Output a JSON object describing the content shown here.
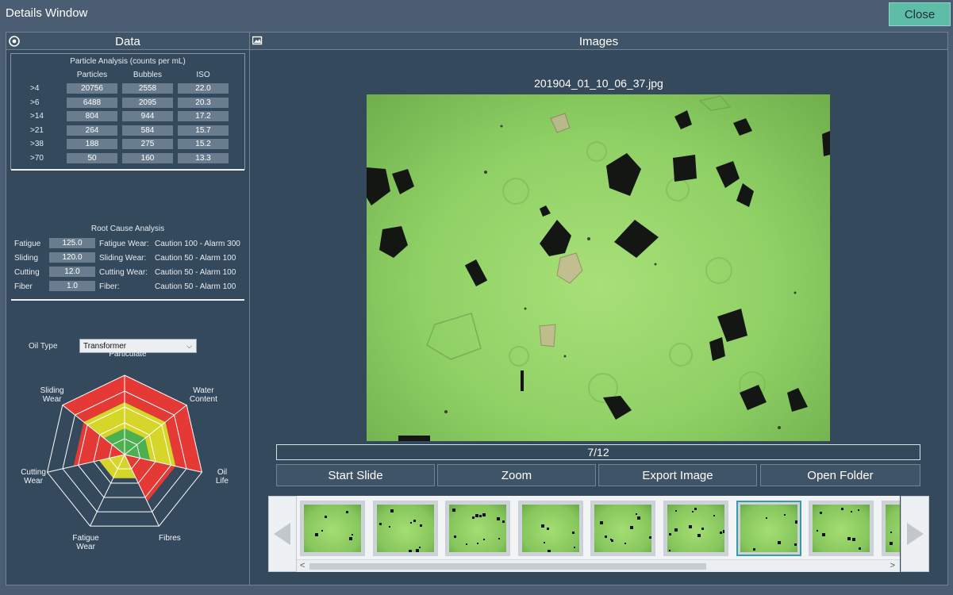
{
  "window": {
    "title": "Details Window",
    "close_label": "Close"
  },
  "data_panel": {
    "title": "Data",
    "particle_analysis": {
      "title": "Particle Analysis (counts per mL)",
      "columns": [
        "Particles",
        "Bubbles",
        "ISO"
      ],
      "rows": [
        {
          "label": ">4",
          "values": [
            "20756",
            "2558",
            "22.0"
          ]
        },
        {
          "label": ">6",
          "values": [
            "6488",
            "2095",
            "20.3"
          ]
        },
        {
          "label": ">14",
          "values": [
            "804",
            "944",
            "17.2"
          ]
        },
        {
          "label": ">21",
          "values": [
            "264",
            "584",
            "15.7"
          ]
        },
        {
          "label": ">38",
          "values": [
            "188",
            "275",
            "15.2"
          ]
        },
        {
          "label": ">70",
          "values": [
            "50",
            "160",
            "13.3"
          ]
        }
      ]
    },
    "root_cause": {
      "title": "Root Cause Analysis",
      "rows": [
        {
          "label": "Fatigue",
          "value": "125.0",
          "name": "Fatigue Wear:",
          "limits": "Caution 100 - Alarm 300"
        },
        {
          "label": "Sliding",
          "value": "120.0",
          "name": "Sliding Wear:",
          "limits": "Caution 50 - Alarm 100"
        },
        {
          "label": "Cutting",
          "value": "12.0",
          "name": "Cutting Wear:",
          "limits": "Caution 50 - Alarm 100"
        },
        {
          "label": "Fiber",
          "value": "1.0",
          "name": "Fiber:",
          "limits": "Caution 50 - Alarm 100"
        }
      ]
    },
    "oil_type": {
      "label": "Oil Type",
      "value": "Transformer"
    },
    "radar": {
      "axes": [
        {
          "name": "Particulate",
          "lines": [
            "Particulate"
          ],
          "level": 1.0
        },
        {
          "name": "Water Content",
          "lines": [
            "Water",
            "Content"
          ],
          "level": 1.0
        },
        {
          "name": "Oil Life",
          "lines": [
            "Oil",
            "Life"
          ],
          "level": 1.0
        },
        {
          "name": "Fibres",
          "lines": [
            "Fibres"
          ],
          "level": 0.0
        },
        {
          "name": "Fatigue Wear",
          "lines": [
            "Fatigue",
            "Wear"
          ],
          "level": 0.5
        },
        {
          "name": "Cutting Wear",
          "lines": [
            "Cutting",
            "Wear"
          ],
          "level": 0.0
        },
        {
          "name": "Sliding Wear",
          "lines": [
            "Sliding",
            "Wear"
          ],
          "level": 1.0
        }
      ],
      "colors": {
        "low": "#4caf50",
        "mid": "#d6d62a",
        "high": "#e53935"
      }
    }
  },
  "images_panel": {
    "title": "Images",
    "filename": "201904_01_10_06_37.jpg",
    "counter": "7/12",
    "buttons": {
      "start_slide": "Start Slide",
      "zoom": "Zoom",
      "export_image": "Export Image",
      "open_folder": "Open Folder"
    },
    "selected_thumbnail_index": 7,
    "visible_thumbnails": 9
  },
  "colors": {
    "accent": "#5ebda6",
    "panel": "#34495c",
    "header": "#3f5467"
  }
}
